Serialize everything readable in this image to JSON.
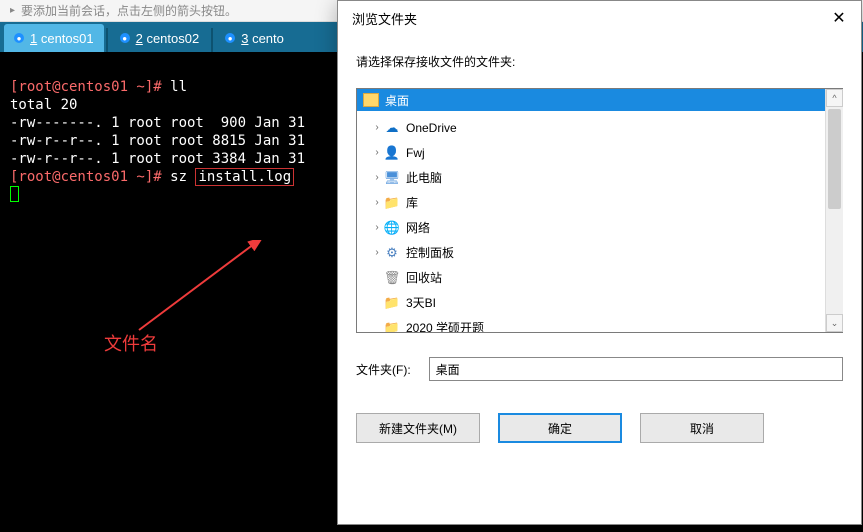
{
  "topbar": {
    "hint": "要添加当前会话，点击左侧的箭头按钮。"
  },
  "tabs": [
    {
      "num": "1",
      "label": "centos01",
      "active": true
    },
    {
      "num": "2",
      "label": "centos02",
      "active": false
    },
    {
      "num": "3",
      "label": "cento",
      "active": false
    }
  ],
  "terminal": {
    "prompt1": "[root@centos01 ~]# ",
    "cmd1": "ll",
    "line_total": "total 20",
    "rows": [
      "-rw-------. 1 root root  900 Jan 31 ",
      "-rw-r--r--. 1 root root 8815 Jan 31 ",
      "-rw-r--r--. 1 root root 3384 Jan 31 "
    ],
    "prompt2": "[root@centos01 ~]# ",
    "cmd2": "sz ",
    "filearg": "install.log"
  },
  "annotation": {
    "label": "文件名"
  },
  "dialog": {
    "title": "浏览文件夹",
    "instruction": "请选择保存接收文件的文件夹:",
    "selected_header": "桌面",
    "tree": [
      {
        "caret": "›",
        "icon": "cloud",
        "label": "OneDrive",
        "cls": "i-onedrive"
      },
      {
        "caret": "›",
        "icon": "user",
        "label": "Fwj",
        "cls": "i-user"
      },
      {
        "caret": "›",
        "icon": "pc",
        "label": "此电脑",
        "cls": "i-pc"
      },
      {
        "caret": "›",
        "icon": "lib",
        "label": "库",
        "cls": "i-lib"
      },
      {
        "caret": "›",
        "icon": "net",
        "label": "网络",
        "cls": "i-net"
      },
      {
        "caret": "›",
        "icon": "cp",
        "label": "控制面板",
        "cls": "i-cp"
      },
      {
        "caret": " ",
        "icon": "trash",
        "label": "回收站",
        "cls": "i-trash"
      },
      {
        "caret": " ",
        "icon": "folder",
        "label": "3天BI",
        "cls": "i-folder"
      },
      {
        "caret": " ",
        "icon": "folder",
        "label": "2020 学硕开题",
        "cls": "i-folder"
      }
    ],
    "field_label": "文件夹(F):",
    "field_value": "桌面",
    "btn_new": "新建文件夹(M)",
    "btn_ok": "确定",
    "btn_cancel": "取消"
  },
  "icons": {
    "cloud": "☁",
    "user": "👤",
    "pc": "🖥",
    "lib": "📁",
    "net": "🌐",
    "cp": "⚙",
    "trash": "🗑",
    "folder": "📁"
  }
}
